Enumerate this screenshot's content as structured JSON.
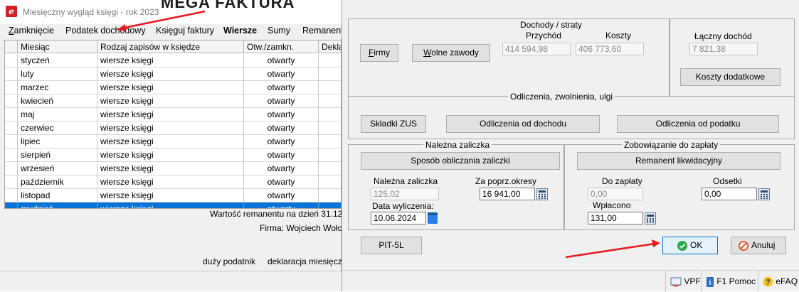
{
  "back_window": {
    "title": "Miesięczny wygląd księgi - rok 2023",
    "brand_fragment": "MEGA  FAKTURA",
    "menu": [
      "Zamknięcie",
      "Podatek dochodowy",
      "Księguj faktury",
      "Wiersze",
      "Sumy",
      "Remanent"
    ],
    "columns": [
      "Miesiąc",
      "Rodzaj zapisów w księdze",
      "Otw./zamkn.",
      "Dekla"
    ],
    "rows": [
      {
        "month": "styczeń",
        "type": "wiersze księgi",
        "status": "otwarty"
      },
      {
        "month": "luty",
        "type": "wiersze księgi",
        "status": "otwarty"
      },
      {
        "month": "marzec",
        "type": "wiersze księgi",
        "status": "otwarty"
      },
      {
        "month": "kwiecień",
        "type": "wiersze księgi",
        "status": "otwarty"
      },
      {
        "month": "maj",
        "type": "wiersze księgi",
        "status": "otwarty"
      },
      {
        "month": "czerwiec",
        "type": "wiersze księgi",
        "status": "otwarty"
      },
      {
        "month": "lipiec",
        "type": "wiersze księgi",
        "status": "otwarty"
      },
      {
        "month": "sierpień",
        "type": "wiersze księgi",
        "status": "otwarty"
      },
      {
        "month": "wrzesień",
        "type": "wiersze księgi",
        "status": "otwarty"
      },
      {
        "month": "październik",
        "type": "wiersze księgi",
        "status": "otwarty"
      },
      {
        "month": "listopad",
        "type": "wiersze księgi",
        "status": "otwarty"
      },
      {
        "month": "grudzień",
        "type": "wiersze księgi",
        "status": "otwarty"
      }
    ],
    "selected_row": 11,
    "remanent_text": "Wartość remanentu na dzień 31.12.",
    "firma_text": "Firma: Wojciech Wołc",
    "tax_type": "duży podatnik",
    "declaration": "deklaracja miesięczn"
  },
  "dialog": {
    "income": {
      "title": "Dochody / straty",
      "firmy_button": "Firmy",
      "wolne_zawody_button": "Wolne zawody",
      "przychod_label": "Przychód",
      "koszty_label": "Koszty",
      "przychod_value": "414 594,98",
      "koszty_value": "406 773,60",
      "laczny_label": "Łączny dochód",
      "laczny_value": "7 821,38",
      "koszty_dodatkowe_button": "Koszty dodatkowe"
    },
    "deductions": {
      "title": "Odliczenia, zwolnienia, ulgi",
      "zus_button": "Składki ZUS",
      "od_dochodu_button": "Odliczenia od dochodu",
      "od_podatku_button": "Odliczenia od podatku"
    },
    "advance": {
      "title": "Należna zaliczka",
      "method_button": "Sposób obliczania zaliczki",
      "due_label": "Należna zaliczka",
      "due_value": "125,02",
      "prev_label": "Za poprz.okresy",
      "prev_value": "16 941,00",
      "date_label": "Data wyliczenia:",
      "date_value": "10.06.2024"
    },
    "liability": {
      "title": "Zobowiązanie do zapłaty",
      "remanent_button": "Remanent likwidacyjny",
      "to_pay_label": "Do zapłaty",
      "to_pay_value": "0,00",
      "interest_label": "Odsetki",
      "interest_value": "0,00",
      "paid_label": "Wpłacono",
      "paid_value": "131,00"
    },
    "pit_button": "PIT-5L",
    "ok_button": "OK",
    "cancel_button": "Anuluj",
    "statusbar": {
      "vpf": "VPF",
      "help": "F1 Pomoc",
      "faq": "eFAQ"
    }
  },
  "colors": {
    "selection": "#0a74d6",
    "arrow": "#e8191c",
    "ok_icon": "#2aa84a",
    "cancel_icon": "#e25b2b",
    "brand_red": "#d81f26"
  },
  "icons": [
    "app-logo-icon",
    "calculator-icon",
    "calendar-icon",
    "ok-check-icon",
    "cancel-icon",
    "vpf-icon",
    "help-icon",
    "faq-icon"
  ]
}
